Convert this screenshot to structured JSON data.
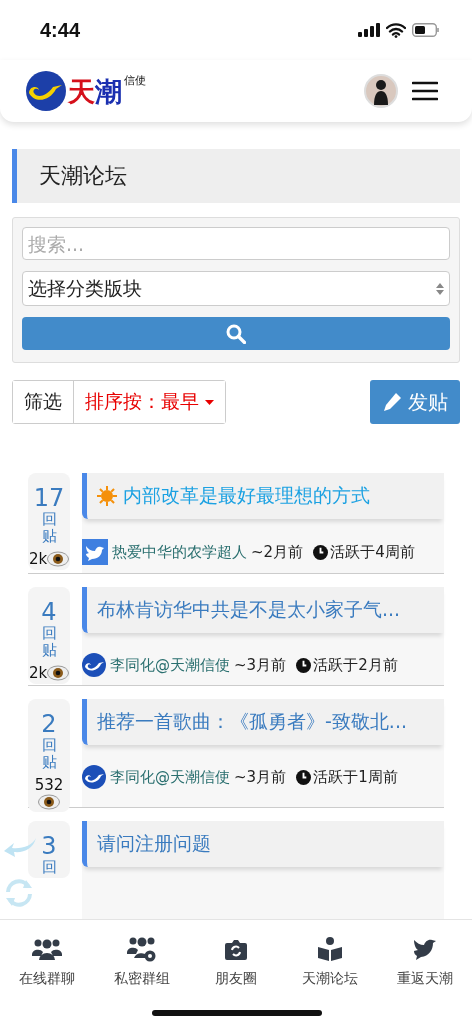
{
  "status_bar": {
    "time": "4:44"
  },
  "header": {
    "logo_text": [
      "天",
      "潮"
    ],
    "logo_subtext": "信使"
  },
  "forum": {
    "title": "天潮论坛",
    "search": {
      "placeholder": "搜索..."
    },
    "category_select": {
      "value": "选择分类版块"
    },
    "filter_button": "筛选",
    "sort_button": "排序按：最早",
    "new_post_button": "发贴"
  },
  "posts": [
    {
      "kind": "featured",
      "replies": "17",
      "replies_label": "回贴",
      "views": "2k",
      "title": "内部改革是最好最理想的方式",
      "avatar": {
        "kind": "dove"
      },
      "author": "热爱中华的农学超人",
      "posted": "~2月前",
      "active": "活跃于4周前"
    },
    {
      "kind": "normal",
      "replies": "4",
      "replies_label": "回贴",
      "views": "2k",
      "title": "布林肯访华中共是不是太小家子气...",
      "avatar": {
        "kind": "logo"
      },
      "author": "李同化@天潮信使",
      "posted": "~3月前",
      "active": "活跃于2月前"
    },
    {
      "kind": "normal",
      "replies": "2",
      "replies_label": "回贴",
      "views": "532",
      "title": "推荐一首歌曲：《孤勇者》-致敬北...",
      "avatar": {
        "kind": "logo"
      },
      "author": "李同化@天潮信使",
      "posted": "~3月前",
      "active": "活跃于1周前"
    },
    {
      "kind": "normal",
      "replies": "3",
      "replies_label": "回",
      "title": "请问注册问题"
    }
  ],
  "bottom_nav": [
    {
      "label": "在线群聊"
    },
    {
      "label": "私密群组"
    },
    {
      "label": "朋友圈"
    },
    {
      "label": "天潮论坛"
    },
    {
      "label": "重返天潮"
    }
  ]
}
